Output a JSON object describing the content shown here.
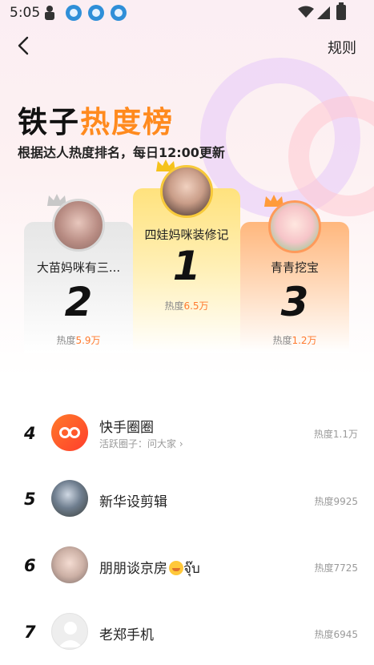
{
  "status_bar": {
    "time": "5:05"
  },
  "header": {
    "back_icon": "chevron-left-icon",
    "rules_label": "规则"
  },
  "hero": {
    "title_black": "铁子",
    "title_orange": "热度榜",
    "subtitle": "根据达人热度排名，每日12:00更新",
    "accent_color": "#ff8a1e"
  },
  "podium": [
    {
      "rank": "1",
      "name": "四娃妈咪装修记",
      "heat_label": "热度",
      "heat_value": "6.5万"
    },
    {
      "rank": "2",
      "name": "大苗妈咪有三...",
      "heat_label": "热度",
      "heat_value": "5.9万"
    },
    {
      "rank": "3",
      "name": "青青挖宝",
      "heat_label": "热度",
      "heat_value": "1.2万"
    }
  ],
  "list": [
    {
      "rank": "4",
      "name": "快手圈圈",
      "sub": "活跃圈子：问大家 ›",
      "heat": "热度1.1万"
    },
    {
      "rank": "5",
      "name": "新华设剪辑",
      "heat": "热度9925"
    },
    {
      "rank": "6",
      "name": "朋朋谈京房",
      "name_suffix": "จุ๊บ",
      "heat": "热度7725"
    },
    {
      "rank": "7",
      "name": "老郑手机",
      "heat": "热度6945"
    }
  ]
}
